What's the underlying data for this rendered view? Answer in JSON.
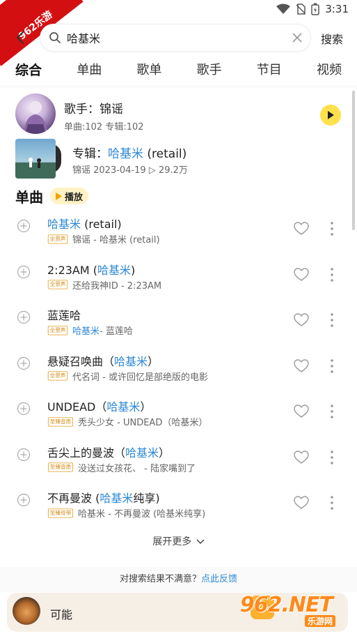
{
  "status_bar": {
    "time": "3:31",
    "corner_badge": "962乐游"
  },
  "search": {
    "query": "哈基米",
    "submit_label": "搜索"
  },
  "tabs": [
    {
      "label": "综合",
      "active": true
    },
    {
      "label": "单曲",
      "active": false
    },
    {
      "label": "歌单",
      "active": false
    },
    {
      "label": "歌手",
      "active": false
    },
    {
      "label": "节目",
      "active": false
    },
    {
      "label": "视频",
      "active": false
    }
  ],
  "artist": {
    "prefix": "歌手：",
    "name": "锦谣",
    "meta": "单曲:102  专辑:102"
  },
  "album": {
    "prefix": "专辑：",
    "title_highlight": "哈基米",
    "title_rest": " (retail)",
    "meta": "锦谣  2023-04-19  ▷ 29.2万"
  },
  "songs_section": {
    "title": "单曲",
    "play_label": "播放"
  },
  "songs": [
    {
      "title_pre": "",
      "title_hl": "哈基米",
      "title_post": " (retail)",
      "badge": "全景声",
      "sub_hl": "",
      "sub": "锦谣 - 哈基米 (retail)"
    },
    {
      "title_pre": "2:23AM (",
      "title_hl": "哈基米",
      "title_post": ")",
      "badge": "全景声",
      "sub_hl": "",
      "sub": "还给我神ID - 2:23AM"
    },
    {
      "title_pre": "蓝莲哈",
      "title_hl": "",
      "title_post": "",
      "badge": "全景声",
      "sub_hl": "哈基米",
      "sub": " - 蓝莲哈"
    },
    {
      "title_pre": "悬疑召唤曲（",
      "title_hl": "哈基米",
      "title_post": "）",
      "badge": "全景声",
      "sub_hl": "",
      "sub": "代名词 - 或许回忆是部绝版的电影"
    },
    {
      "title_pre": "UNDEAD（",
      "title_hl": "哈基米",
      "title_post": "）",
      "badge": "至臻音质",
      "sub_hl": "",
      "sub": "秃头少女 - UNDEAD（哈基米）"
    },
    {
      "title_pre": "舌尖上的曼波（",
      "title_hl": "哈基米",
      "title_post": "）",
      "badge": "至臻音质",
      "sub_hl": "",
      "sub": "没送过女孩花、 - 陆家嘴到了"
    },
    {
      "title_pre": "不再曼波 (",
      "title_hl": "哈基米",
      "title_post": "纯享)",
      "badge": "至臻母带",
      "sub_hl": "",
      "sub": "哈基米 - 不再曼波 (哈基米纯享)"
    }
  ],
  "expand_more": "展开更多",
  "feedback": {
    "text": "对搜索结果不满意？",
    "link": "点此反馈"
  },
  "player": {
    "title": "可能"
  },
  "watermark": {
    "brand": "962.NET",
    "sub": "乐游网"
  },
  "colors": {
    "accent_yellow": "#ffe14d",
    "highlight_blue": "#2d88d6",
    "badge_orange": "#d58a12"
  },
  "icons": [
    "back-arrow-icon",
    "search-icon",
    "clear-icon",
    "play-icon",
    "add-icon",
    "heart-icon",
    "more-vertical-icon",
    "chevron-down-icon",
    "wifi-icon",
    "battery-icon"
  ]
}
